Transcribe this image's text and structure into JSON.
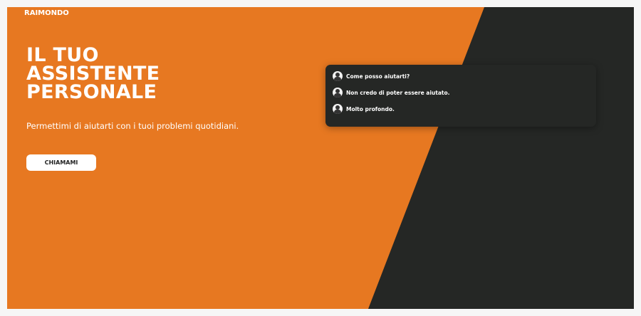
{
  "brand": "RAIMONDO",
  "hero": {
    "title_lines": [
      "IL TUO",
      "ASSISTENTE",
      "PERSONALE"
    ],
    "subtitle": "Permettimi di aiutarti con i tuoi problemi quotidiani.",
    "cta_label": "CHIAMAMI"
  },
  "chat": {
    "messages": [
      {
        "text": "Come posso aiutarti?",
        "icon": "user-avatar-icon"
      },
      {
        "text": "Non credo di poter essere aiutato.",
        "icon": "user-avatar-icon"
      },
      {
        "text": "Molto profondo.",
        "icon": "user-avatar-icon"
      }
    ]
  },
  "colors": {
    "accent": "#e77821",
    "dark": "#252725"
  }
}
